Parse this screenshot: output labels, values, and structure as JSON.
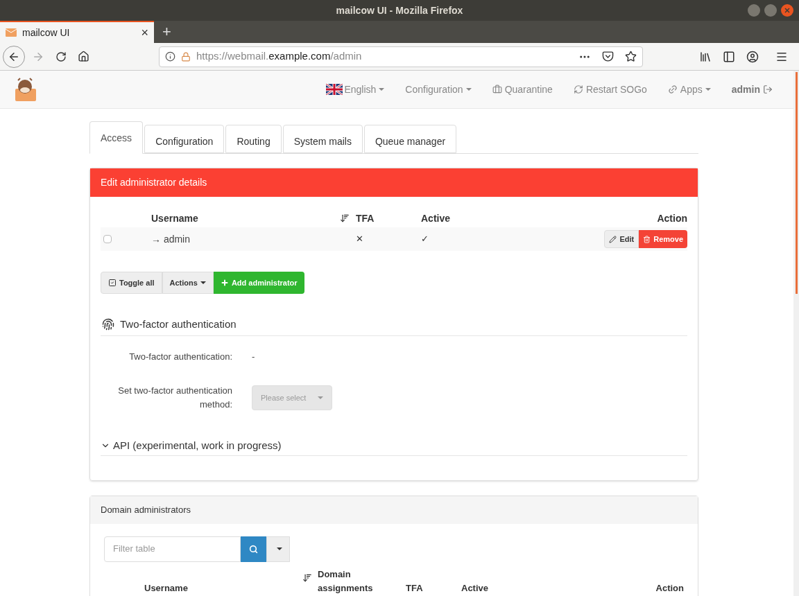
{
  "window": {
    "title": "mailcow UI - Mozilla Firefox"
  },
  "browser_tab": {
    "title": "mailcow UI",
    "close": "×"
  },
  "new_tab": "+",
  "url": {
    "prefix": "https://webmail.",
    "domain": "example.com",
    "path": "/admin"
  },
  "navbar": [
    {
      "kind": "language",
      "label": "English",
      "caret": true,
      "bold": false
    },
    {
      "kind": "plain",
      "label": "Configuration",
      "caret": true,
      "bold": false
    },
    {
      "kind": "quarantine",
      "label": "Quarantine",
      "caret": false,
      "bold": false
    },
    {
      "kind": "restart",
      "label": "Restart SOGo",
      "caret": false,
      "bold": false
    },
    {
      "kind": "apps",
      "label": "Apps",
      "caret": true,
      "bold": false
    },
    {
      "kind": "logout",
      "label": "admin",
      "caret": false,
      "bold": true
    }
  ],
  "tabs": [
    {
      "label": "Access",
      "selected": true
    },
    {
      "label": "Configuration",
      "selected": false
    },
    {
      "label": "Routing",
      "selected": false
    },
    {
      "label": "System mails",
      "selected": false
    },
    {
      "label": "Queue manager",
      "selected": false
    }
  ],
  "admin_panel": {
    "title": "Edit administrator details",
    "columns": [
      "Username",
      "TFA",
      "Active",
      "Action"
    ],
    "rows": [
      {
        "checked": false,
        "username": "→ admin",
        "tfa": "✕",
        "active": "✓",
        "edit": "Edit",
        "remove": "Remove"
      }
    ],
    "toggle_all": "Toggle all",
    "actions": "Actions",
    "add": "Add administrator",
    "tfa_section": {
      "title": "Two-factor authentication",
      "status_label": "Two-factor authentication:",
      "status_value": "-",
      "method_label": "Set two-factor authentication method:",
      "method_placeholder": "Please select",
      "method_disabled": true
    },
    "api_section": {
      "title": "API (experimental, work in progress)",
      "expanded": false
    }
  },
  "domain_panel": {
    "title": "Domain administrators",
    "filter_placeholder": "Filter table",
    "columns": [
      "Username",
      "Domain assignments",
      "TFA",
      "Active",
      "Action"
    ]
  }
}
